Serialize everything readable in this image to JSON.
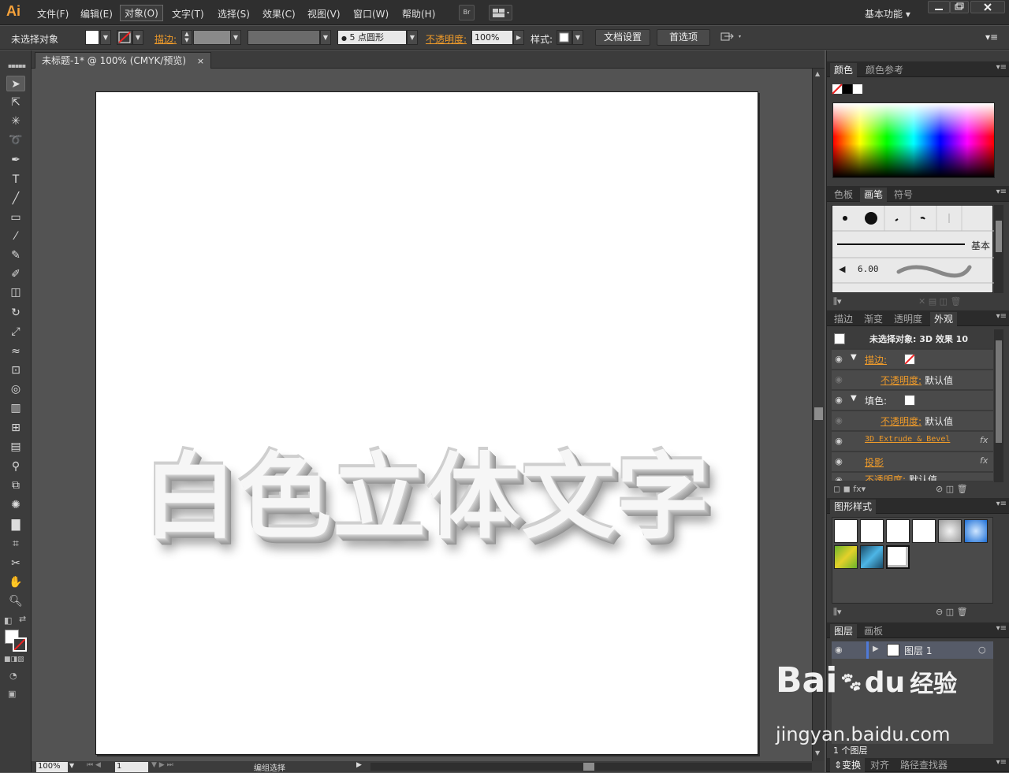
{
  "app": {
    "logo": "Ai",
    "workspace": "基本功能"
  },
  "menu": [
    "文件(F)",
    "编辑(E)",
    "对象(O)",
    "文字(T)",
    "选择(S)",
    "效果(C)",
    "视图(V)",
    "窗口(W)",
    "帮助(H)"
  ],
  "bridge": "Br",
  "control": {
    "selection": "未选择对象",
    "stroke_label": "描边:",
    "bullet": "●",
    "brush_size": "5",
    "brush_shape": "点圆形",
    "opacity_label": "不透明度:",
    "opacity_value": "100%",
    "style_label": "样式:",
    "doc_setup": "文档设置",
    "preferences": "首选项"
  },
  "document": {
    "tab_title": "未标题-1* @ 100% (CMYK/预览)",
    "close": "×",
    "artwork_text": "白色立体文字"
  },
  "status": {
    "zoom": "100%",
    "page": "1",
    "tool": "编组选择"
  },
  "color_panel": {
    "tabs": [
      "颜色",
      "颜色参考"
    ]
  },
  "brush_panel": {
    "tabs": [
      "色板",
      "画笔",
      "符号"
    ],
    "basic_label": "基本",
    "size_value": "6.00"
  },
  "appearance_panel": {
    "tabs": [
      "描边",
      "渐变",
      "透明度",
      "外观"
    ],
    "header": "未选择对象: 3D 效果 10",
    "rows": {
      "stroke": "描边:",
      "opacity1": "不透明度:",
      "default1": "默认值",
      "fill": "填色:",
      "opacity2": "不透明度:",
      "default2": "默认值",
      "extrude": "3D Extrude & Bevel",
      "shadow": "投影",
      "opacity3": "不透明度:",
      "default3": "默认值",
      "fx": "fx"
    }
  },
  "graphic_styles": {
    "title": "图形样式"
  },
  "layers_panel": {
    "tabs": [
      "图层",
      "画板"
    ],
    "layer_name": "图层 1",
    "count": "1 个图层"
  },
  "bottom_tabs": [
    "变换",
    "对齐",
    "路径查找器"
  ],
  "watermark": {
    "brand": "Bai",
    "brand2": "du",
    "brand3": "经验",
    "url": "jingyan.baidu.com"
  },
  "colors": {
    "accent": "#ef9b2a",
    "logo": "#f7a23a",
    "bg": "#535353"
  }
}
